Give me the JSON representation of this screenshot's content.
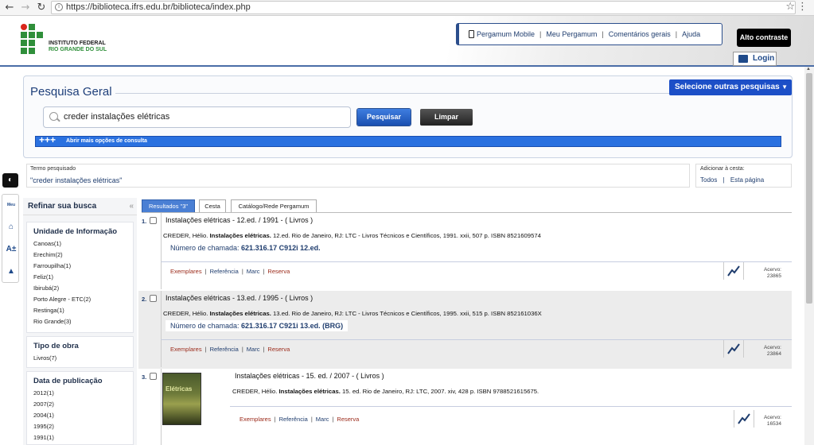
{
  "browser": {
    "url": "https://biblioteca.ifrs.edu.br/biblioteca/index.php"
  },
  "header": {
    "logo_line1": "INSTITUTO FEDERAL",
    "logo_line2": "RIO GRANDE DO SUL",
    "menu": {
      "mobile": "Pergamum Mobile",
      "my": "Meu Pergamum",
      "comments": "Comentários gerais",
      "help": "Ajuda"
    },
    "contrast": "Alto contraste",
    "login": "Login"
  },
  "search": {
    "title": "Pesquisa Geral",
    "other_searches": "Selecione outras pesquisas",
    "query": "creder instalações elétricas",
    "search_btn": "Pesquisar",
    "clear_btn": "Limpar",
    "more_options": "Abrir mais opções de consulta"
  },
  "term": {
    "label": "Termo pesquisado",
    "value": "\"creder instalações elétricas\""
  },
  "cart": {
    "label": "Adicionar à cesta:",
    "all": "Todos",
    "page": "Esta página"
  },
  "refine": {
    "title": "Refinar sua busca",
    "facets": {
      "unit": {
        "title": "Unidade de Informação",
        "items": [
          "Canoas(1)",
          "Erechim(2)",
          "Farroupilha(1)",
          "Feliz(1)",
          "Ibirubá(2)",
          "Porto Alegre - ETC(2)",
          "Restinga(1)",
          "Rio Grande(3)"
        ]
      },
      "type": {
        "title": "Tipo de obra",
        "items": [
          "Livros(7)"
        ]
      },
      "date": {
        "title": "Data de publicação",
        "items": [
          "2012(1)",
          "2007(2)",
          "2004(1)",
          "1995(2)",
          "1991(1)"
        ]
      }
    }
  },
  "tabs": {
    "results": "Resultados \"3\"",
    "basket": "Cesta",
    "catalog": "Catálogo/Rede Pergamum"
  },
  "results": [
    {
      "num": "1.",
      "title": "Instalações elétricas - 12.ed. / 1991 -  ( Livros )",
      "ref_author": "CREDER, Hélio. ",
      "ref_title": "Instalações elétricas.",
      "ref_rest": " 12.ed. Rio de Janeiro, RJ: LTC - Livros Técnicos e Científicos, 1991. xxii, 507 p. ISBN 8521609574",
      "call_label": "Número de chamada: ",
      "call_value": "621.316.17 C912i 12.ed.",
      "acervo_label": "Acervo:",
      "acervo_value": "23865"
    },
    {
      "num": "2.",
      "title": "Instalações elétricas - 13.ed. / 1995 -  ( Livros )",
      "ref_author": "CREDER, Hélio. ",
      "ref_title": "Instalações elétricas.",
      "ref_rest": " 13.ed. Rio de Janeiro, RJ: LTC - Livros Técnicos e Científicos, 1995. xxii, 515 p. ISBN 852161036X",
      "call_label": "Número de chamada: ",
      "call_value": "621.316.17 C921i 13.ed. (BRG)",
      "acervo_label": "Acervo:",
      "acervo_value": "23864"
    },
    {
      "num": "3.",
      "title": "Instalações elétricas - 15. ed. / 2007 -  ( Livros )",
      "ref_author": "CREDER, Hélio. ",
      "ref_title": "Instalações elétricas.",
      "ref_rest": " 15. ed. Rio de Janeiro, RJ: LTC, 2007. xiv, 428 p. ISBN 9788521615675.",
      "cover_text": "Elétricas",
      "acervo_label": "Acervo:",
      "acervo_value": "16534"
    }
  ],
  "result_links": {
    "copies": "Exemplares",
    "reference": "Referência",
    "marc": "Marc",
    "reserve": "Reserva"
  }
}
